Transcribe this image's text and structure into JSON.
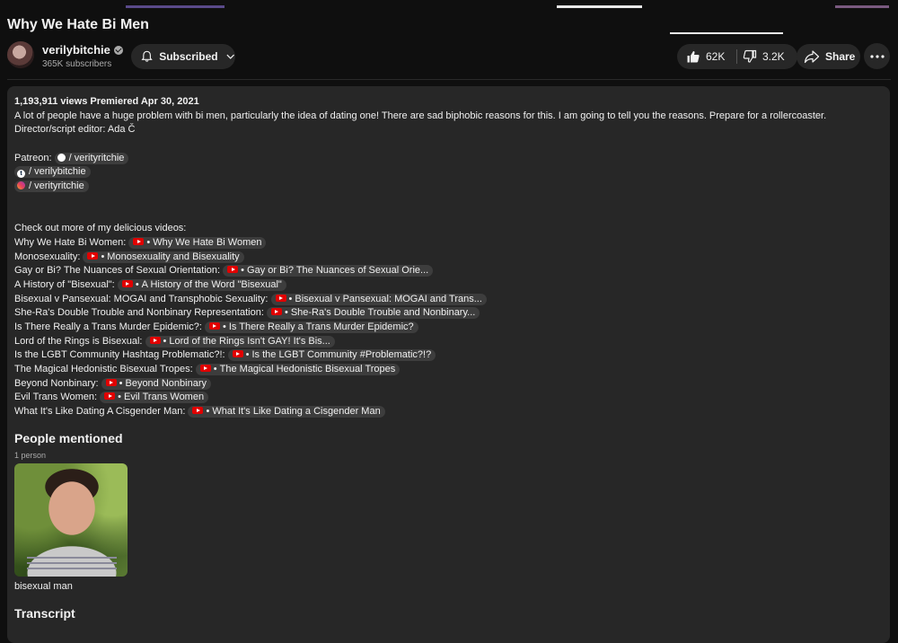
{
  "video": {
    "title": "Why We Hate Bi Men",
    "channel_name": "verilybitchie",
    "subscribers": "365K subscribers",
    "subscribe_label": "Subscribed",
    "likes": "62K",
    "dislikes": "3.2K",
    "share_label": "Share"
  },
  "description": {
    "stats": "1,193,911 views  Premiered Apr 30, 2021",
    "intro": "A lot of people have a huge problem with bi men, particularly the idea of dating one! There are sad biphobic reasons for this. I am going to tell you the reasons. Prepare for a rollercoaster.",
    "credit": "Director/script editor: Ada Č",
    "patreon_label": "Patreon:",
    "socials": [
      {
        "icon": "patreon-icon",
        "text": "/ verityritchie"
      },
      {
        "icon": "tumblr-icon",
        "text": "/ verilybitchie"
      },
      {
        "icon": "instagram-icon",
        "text": "/ verityritchie"
      }
    ],
    "more_videos_label": "Check out more of my delicious videos:",
    "links": [
      {
        "label": "Why We Hate Bi Women:",
        "chip": "Why We Hate Bi Women"
      },
      {
        "label": "Monosexuality:",
        "chip": "Monosexuality and Bisexuality"
      },
      {
        "label": "Gay or Bi? The Nuances of Sexual Orientation:",
        "chip": "Gay or Bi? The Nuances of Sexual Orie..."
      },
      {
        "label": "A History of \"Bisexual\":",
        "chip": "A History of the Word \"Bisexual\""
      },
      {
        "label": "Bisexual v Pansexual: MOGAI and Transphobic Sexuality:",
        "chip": "Bisexual v Pansexual: MOGAI and Trans..."
      },
      {
        "label": "She-Ra's Double Trouble and Nonbinary Representation:",
        "chip": "She-Ra's Double Trouble and Nonbinary..."
      },
      {
        "label": "Is There Really a Trans Murder Epidemic?:",
        "chip": "Is There Really a Trans Murder Epidemic?"
      },
      {
        "label": "Lord of the Rings is Bisexual:",
        "chip": "Lord of the Rings Isn't GAY! It's Bis..."
      },
      {
        "label": "Is the LGBT Community  Hashtag Problematic?!:",
        "chip": "Is the LGBT Community #Problematic?!?"
      },
      {
        "label": "The Magical Hedonistic Bisexual Tropes:",
        "chip": "The Magical Hedonistic Bisexual Tropes"
      },
      {
        "label": "Beyond Nonbinary:",
        "chip": "Beyond Nonbinary"
      },
      {
        "label": "Evil Trans Women:",
        "chip": "Evil Trans Women"
      },
      {
        "label": "What It's Like Dating A Cisgender Man:",
        "chip": "What It's Like Dating a Cisgender Man"
      }
    ],
    "people_heading": "People mentioned",
    "people_count": "1 person",
    "person_name": "bisexual man",
    "transcript_heading": "Transcript"
  },
  "colors": {
    "background": "#0f0f0f",
    "panel": "#272727",
    "chip": "#3d3d3d",
    "youtube_red": "#e10000"
  }
}
